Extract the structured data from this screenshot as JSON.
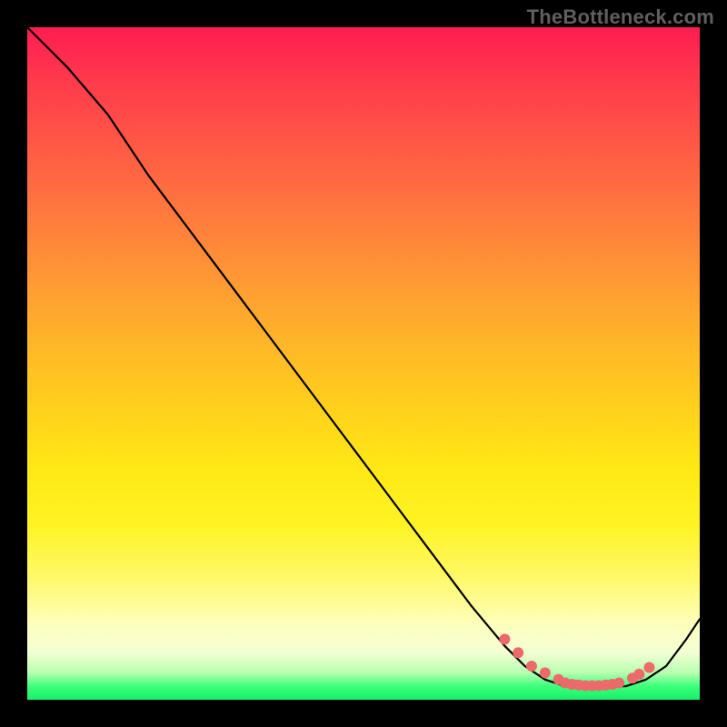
{
  "watermark": "TheBottleneck.com",
  "chart_data": {
    "type": "line",
    "title": "",
    "xlabel": "",
    "ylabel": "",
    "xlim": [
      0,
      100
    ],
    "ylim": [
      0,
      100
    ],
    "grid": false,
    "legend": false,
    "colors": {
      "gradient_top": "#ff1c52",
      "gradient_mid": "#ffe915",
      "gradient_bottom": "#17f06a",
      "line": "#000000",
      "points": "#ec6a6a",
      "frame": "#000000"
    },
    "series": [
      {
        "name": "bottleneck-curve",
        "x": [
          0,
          6,
          12,
          18,
          24,
          30,
          36,
          42,
          48,
          54,
          60,
          66,
          71,
          74,
          77,
          80,
          83,
          86,
          89,
          92,
          95,
          98,
          100
        ],
        "y": [
          100,
          94,
          87,
          78,
          70,
          62,
          54,
          46,
          38,
          30,
          22,
          14,
          8,
          5,
          3,
          2,
          2,
          2,
          2,
          3,
          5,
          9,
          12
        ]
      }
    ],
    "points_overlay": {
      "name": "highlight-points",
      "x": [
        71,
        73,
        75,
        77,
        79,
        80,
        81,
        82,
        83,
        84,
        85,
        86,
        87,
        88,
        90,
        91,
        92.5
      ],
      "y": [
        9,
        7,
        5,
        4,
        3,
        2.5,
        2.3,
        2.2,
        2.1,
        2.1,
        2.1,
        2.2,
        2.3,
        2.5,
        3.2,
        3.8,
        4.8
      ],
      "color": "#ec6a6a",
      "radius": 6
    }
  }
}
